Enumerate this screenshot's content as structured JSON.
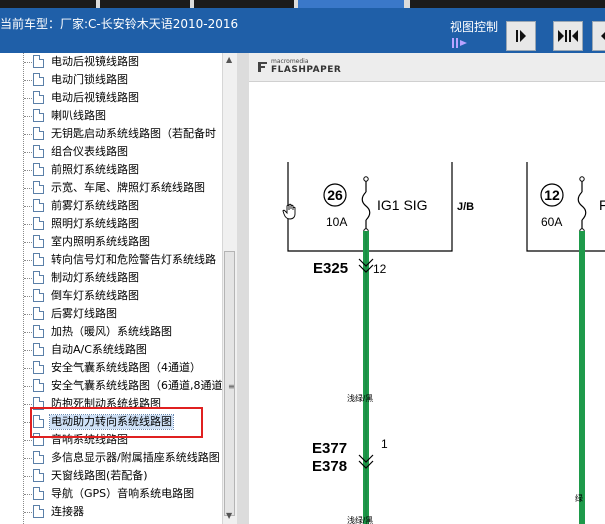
{
  "header": {
    "model_label": "当前车型：厂家:C-长安铃木天语2010-2016",
    "view_control_label": "视图控制"
  },
  "tree_items": [
    {
      "label": "电动后视镜线路图"
    },
    {
      "label": "电动门锁线路图"
    },
    {
      "label": "电动后视镜线路图"
    },
    {
      "label": "喇叭线路图"
    },
    {
      "label": "无钥匙启动系统线路图（若配备时"
    },
    {
      "label": "组合仪表线路图"
    },
    {
      "label": "前照灯系统线路图"
    },
    {
      "label": "示宽、车尾、牌照灯系统线路图"
    },
    {
      "label": "前雾灯系统线路图"
    },
    {
      "label": "照明灯系统线路图"
    },
    {
      "label": "室内照明系统线路图"
    },
    {
      "label": "转向信号灯和危险警告灯系统线路"
    },
    {
      "label": "制动灯系统线路图"
    },
    {
      "label": "倒车灯系统线路图"
    },
    {
      "label": "后雾灯线路图"
    },
    {
      "label": "加热（暖风）系统线路图"
    },
    {
      "label": "自动A/C系统线路图"
    },
    {
      "label": "安全气囊系统线路图（4通道）"
    },
    {
      "label": "安全气囊系统线路图（6通道,8通道"
    },
    {
      "label": "防抱死制动系统线路图"
    },
    {
      "label": "电动助力转向系统线路图",
      "selected": true
    },
    {
      "label": "音响系统线路图"
    },
    {
      "label": "多信息显示器/附属插座系统线路图"
    },
    {
      "label": "天窗线路图(若配备)"
    },
    {
      "label": "导航（GPS）音响系统电路图"
    },
    {
      "label": "连接器"
    }
  ],
  "viewer": {
    "brand_small": "macromedia",
    "brand_large": "FLASHPAPER"
  },
  "diagram": {
    "fuse1_number": "26",
    "fuse1_amp": "10A",
    "fuse1_name": "IG1 SIG",
    "box_label": "J/B",
    "fuse2_number": "12",
    "fuse2_amp": "60A",
    "fuse2_name_partial": "F",
    "conn1": "E325",
    "conn1_pin": "12",
    "wire_color1": "浅绿/黑",
    "conn2a": "E377",
    "conn2b": "E378",
    "conn2_pin": "1",
    "wire_color2": "绿",
    "wire_color3": "浅绿/黑"
  },
  "colors": {
    "header_bg": "#1f5fa8",
    "wire_green": "#1e9a4a",
    "highlight_box": "#e02020"
  }
}
